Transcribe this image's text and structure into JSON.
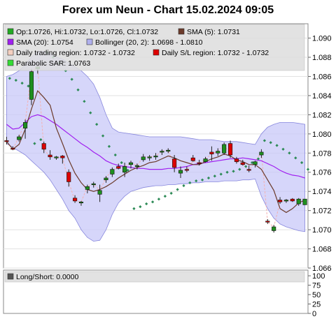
{
  "chart_data": {
    "type": "candlestick",
    "title": "Forex um Neun - Chart 15.02.2024 09:05",
    "main_panel": {
      "ylim": [
        1.066,
        1.0915
      ],
      "y_ticks": [
        "1.066",
        "1.068",
        "1.070",
        "1.072",
        "1.074",
        "1.076",
        "1.078",
        "1.080",
        "1.082",
        "1.084",
        "1.086",
        "1.088",
        "1.090"
      ],
      "grid": true,
      "legend": [
        {
          "label": "Op:1.0726, Hi:1.0732, Lo:1.0726, Cl:1.0732",
          "color": "#22aa22"
        },
        {
          "label": "SMA (5): 1.0731",
          "color": "#6b3a2a"
        },
        {
          "label": "SMA (20): 1.0754",
          "color": "#a020f0"
        },
        {
          "label": "Bollinger (20, 2): 1.0698 - 1.0810",
          "color": "#b0b0ee"
        },
        {
          "label": "Daily trading region: 1.0732 - 1.0732",
          "color": "#f4d0c0"
        },
        {
          "label": "Daily S/L region: 1.0732 - 1.0732",
          "color": "#dd0000"
        },
        {
          "label": "Parabolic SAR: 1.0763",
          "color": "#33dd33"
        }
      ],
      "candles": [
        {
          "o": 1.0793,
          "h": 1.0797,
          "l": 1.0789,
          "c": 1.0792
        },
        {
          "o": 1.0785,
          "h": 1.0787,
          "l": 1.0783,
          "c": 1.0784
        },
        {
          "o": 1.0794,
          "h": 1.0799,
          "l": 1.0792,
          "c": 1.0797
        },
        {
          "o": 1.0806,
          "h": 1.0815,
          "l": 1.0795,
          "c": 1.0812
        },
        {
          "o": 1.0836,
          "h": 1.0868,
          "l": 1.083,
          "c": 1.0865
        },
        {
          "o": 1.0868,
          "h": 1.0875,
          "l": 1.0863,
          "c": 1.087
        },
        {
          "o": 1.079,
          "h": 1.0792,
          "l": 1.078,
          "c": 1.0784
        },
        {
          "o": 1.0778,
          "h": 1.0783,
          "l": 1.0773,
          "c": 1.0776
        },
        {
          "o": 1.0775,
          "h": 1.0777,
          "l": 1.0773,
          "c": 1.0776
        },
        {
          "o": 1.0777,
          "h": 1.0778,
          "l": 1.0769,
          "c": 1.0775
        },
        {
          "o": 1.076,
          "h": 1.0763,
          "l": 1.0745,
          "c": 1.075
        },
        {
          "o": 1.0733,
          "h": 1.0736,
          "l": 1.0728,
          "c": 1.073
        },
        {
          "o": 1.0728,
          "h": 1.073,
          "l": 1.0725,
          "c": 1.0729
        },
        {
          "o": 1.0742,
          "h": 1.0747,
          "l": 1.0738,
          "c": 1.0745
        },
        {
          "o": 1.0747,
          "h": 1.075,
          "l": 1.0744,
          "c": 1.0748
        },
        {
          "o": 1.0737,
          "h": 1.0747,
          "l": 1.0729,
          "c": 1.0741
        },
        {
          "o": 1.0752,
          "h": 1.0756,
          "l": 1.0749,
          "c": 1.0754
        },
        {
          "o": 1.0758,
          "h": 1.0765,
          "l": 1.0755,
          "c": 1.0763
        },
        {
          "o": 1.0766,
          "h": 1.0769,
          "l": 1.0763,
          "c": 1.0764
        },
        {
          "o": 1.076,
          "h": 1.077,
          "l": 1.0755,
          "c": 1.0766
        },
        {
          "o": 1.0768,
          "h": 1.0772,
          "l": 1.0764,
          "c": 1.077
        },
        {
          "o": 1.0766,
          "h": 1.0769,
          "l": 1.0763,
          "c": 1.0767
        },
        {
          "o": 1.0773,
          "h": 1.0779,
          "l": 1.0771,
          "c": 1.0776
        },
        {
          "o": 1.0775,
          "h": 1.0778,
          "l": 1.0772,
          "c": 1.0776
        },
        {
          "o": 1.0776,
          "h": 1.078,
          "l": 1.0773,
          "c": 1.0777
        },
        {
          "o": 1.0782,
          "h": 1.0784,
          "l": 1.0778,
          "c": 1.0782
        },
        {
          "o": 1.0782,
          "h": 1.0785,
          "l": 1.078,
          "c": 1.0783
        },
        {
          "o": 1.0774,
          "h": 1.0778,
          "l": 1.076,
          "c": 1.0765
        },
        {
          "o": 1.0759,
          "h": 1.0766,
          "l": 1.0754,
          "c": 1.0762
        },
        {
          "o": 1.0763,
          "h": 1.0766,
          "l": 1.076,
          "c": 1.0762
        },
        {
          "o": 1.0775,
          "h": 1.0778,
          "l": 1.0771,
          "c": 1.0772
        },
        {
          "o": 1.077,
          "h": 1.0773,
          "l": 1.0767,
          "c": 1.0769
        },
        {
          "o": 1.0771,
          "h": 1.0776,
          "l": 1.077,
          "c": 1.0774
        },
        {
          "o": 1.0781,
          "h": 1.0787,
          "l": 1.0772,
          "c": 1.0779
        },
        {
          "o": 1.078,
          "h": 1.0785,
          "l": 1.0777,
          "c": 1.0782
        },
        {
          "o": 1.078,
          "h": 1.0791,
          "l": 1.0778,
          "c": 1.0789
        },
        {
          "o": 1.079,
          "h": 1.0793,
          "l": 1.0775,
          "c": 1.0778
        },
        {
          "o": 1.0774,
          "h": 1.0776,
          "l": 1.0769,
          "c": 1.0771
        },
        {
          "o": 1.077,
          "h": 1.0773,
          "l": 1.0767,
          "c": 1.0768
        },
        {
          "o": 1.0763,
          "h": 1.0767,
          "l": 1.076,
          "c": 1.0762
        },
        {
          "o": 1.0768,
          "h": 1.0772,
          "l": 1.0765,
          "c": 1.0771
        },
        {
          "o": 1.0778,
          "h": 1.0784,
          "l": 1.0775,
          "c": 1.0781
        },
        {
          "o": 1.0709,
          "h": 1.0711,
          "l": 1.0706,
          "c": 1.0708
        },
        {
          "o": 1.0699,
          "h": 1.0705,
          "l": 1.0697,
          "c": 1.0703
        },
        {
          "o": 1.0731,
          "h": 1.0734,
          "l": 1.0727,
          "c": 1.0729
        },
        {
          "o": 1.073,
          "h": 1.0732,
          "l": 1.0728,
          "c": 1.0731
        },
        {
          "o": 1.0732,
          "h": 1.0733,
          "l": 1.0729,
          "c": 1.073
        },
        {
          "o": 1.0727,
          "h": 1.0733,
          "l": 1.0725,
          "c": 1.0732
        },
        {
          "o": 1.0726,
          "h": 1.0732,
          "l": 1.0726,
          "c": 1.0732
        }
      ],
      "sma5": [
        1.0792,
        1.0784,
        1.0789,
        1.0805,
        1.0826,
        1.0845,
        1.0838,
        1.083,
        1.0806,
        1.079,
        1.0773,
        1.0759,
        1.0749,
        1.0742,
        1.074,
        1.0742,
        1.0745,
        1.0749,
        1.0754,
        1.0758,
        1.0762,
        1.0765,
        1.0767,
        1.077,
        1.0771,
        1.0774,
        1.0777,
        1.0775,
        1.0772,
        1.077,
        1.0768,
        1.0768,
        1.0771,
        1.0774,
        1.0776,
        1.0779,
        1.0777,
        1.0773,
        1.0771,
        1.0768,
        1.0768,
        1.0763,
        1.0752,
        1.0741,
        1.0722,
        1.0718,
        1.0722,
        1.0728,
        1.0731
      ],
      "sma20": [
        1.081,
        1.0805,
        1.0806,
        1.0812,
        1.0818,
        1.082,
        1.0818,
        1.0814,
        1.081,
        1.0805,
        1.08,
        1.0795,
        1.079,
        1.0786,
        1.0781,
        1.0777,
        1.0772,
        1.0769,
        1.0767,
        1.0766,
        1.0765,
        1.0764,
        1.0764,
        1.0763,
        1.0763,
        1.0763,
        1.0764,
        1.0764,
        1.0765,
        1.0766,
        1.0768,
        1.0769,
        1.077,
        1.0771,
        1.0772,
        1.0773,
        1.0774,
        1.0774,
        1.0775,
        1.0774,
        1.0773,
        1.0772,
        1.0769,
        1.0766,
        1.0762,
        1.0759,
        1.0757,
        1.0756,
        1.0754
      ],
      "boll_upper": [
        1.086,
        1.0862,
        1.0866,
        1.0872,
        1.088,
        1.0886,
        1.0886,
        1.0884,
        1.088,
        1.0878,
        1.0874,
        1.087,
        1.0866,
        1.086,
        1.0852,
        1.0838,
        1.082,
        1.0806,
        1.0802,
        1.0801,
        1.08,
        1.0799,
        1.0798,
        1.0797,
        1.0797,
        1.0797,
        1.0797,
        1.0797,
        1.0797,
        1.0796,
        1.0795,
        1.0794,
        1.0794,
        1.0794,
        1.0793,
        1.0792,
        1.0792,
        1.0792,
        1.0791,
        1.079,
        1.0789,
        1.08,
        1.0807,
        1.081,
        1.0812,
        1.0812,
        1.0812,
        1.0811,
        1.081
      ],
      "boll_lower": [
        1.079,
        1.0786,
        1.0782,
        1.0778,
        1.0772,
        1.0766,
        1.076,
        1.0752,
        1.0742,
        1.0732,
        1.072,
        1.0712,
        1.07,
        1.0692,
        1.0688,
        1.0689,
        1.07,
        1.0716,
        1.0728,
        1.0735,
        1.074,
        1.0742,
        1.0744,
        1.0745,
        1.0746,
        1.0746,
        1.0747,
        1.0747,
        1.0748,
        1.0748,
        1.0749,
        1.0749,
        1.075,
        1.075,
        1.075,
        1.0751,
        1.0751,
        1.0751,
        1.0752,
        1.0752,
        1.0753,
        1.0735,
        1.0722,
        1.0712,
        1.0706,
        1.0703,
        1.0701,
        1.0699,
        1.0698
      ],
      "sar": [
        1.0858,
        1.0856,
        1.0853,
        1.085,
        1.079,
        1.0794,
        1.0885,
        1.088,
        1.0874,
        1.0866,
        1.0857,
        1.0846,
        1.0834,
        1.0822,
        1.081,
        1.0798,
        1.0787,
        1.0778,
        1.077,
        1.0762,
        1.0722,
        1.0724,
        1.0727,
        1.0729,
        1.0732,
        1.0735,
        1.0738,
        1.0742,
        1.0746,
        1.0749,
        1.0751,
        1.0752,
        1.0754,
        1.0756,
        1.0758,
        1.076,
        1.0761,
        1.0763,
        1.0766,
        1.077,
        1.0774,
        1.0793,
        1.0791,
        1.0788,
        1.0784,
        1.078,
        1.0775,
        1.077,
        1.0763
      ],
      "sar_offset": 0.5
    },
    "sub_panel": {
      "legend": [
        {
          "label": "Long/Short: 0.0000",
          "color": "#555555"
        }
      ],
      "ylim": [
        0,
        115
      ],
      "y_ticks": [
        "0",
        "25",
        "50",
        "75",
        "100"
      ],
      "values": []
    },
    "colors": {
      "bullish": "#1f8f1f",
      "bearish": "#dd0000",
      "sma5": "#6b3a2a",
      "sma20": "#a020f0",
      "bollinger_fill": "#c8c8f8",
      "bollinger_line": "#8888dd",
      "daily_trading": "#f4b0b0",
      "sar": "#2e8b57"
    }
  }
}
